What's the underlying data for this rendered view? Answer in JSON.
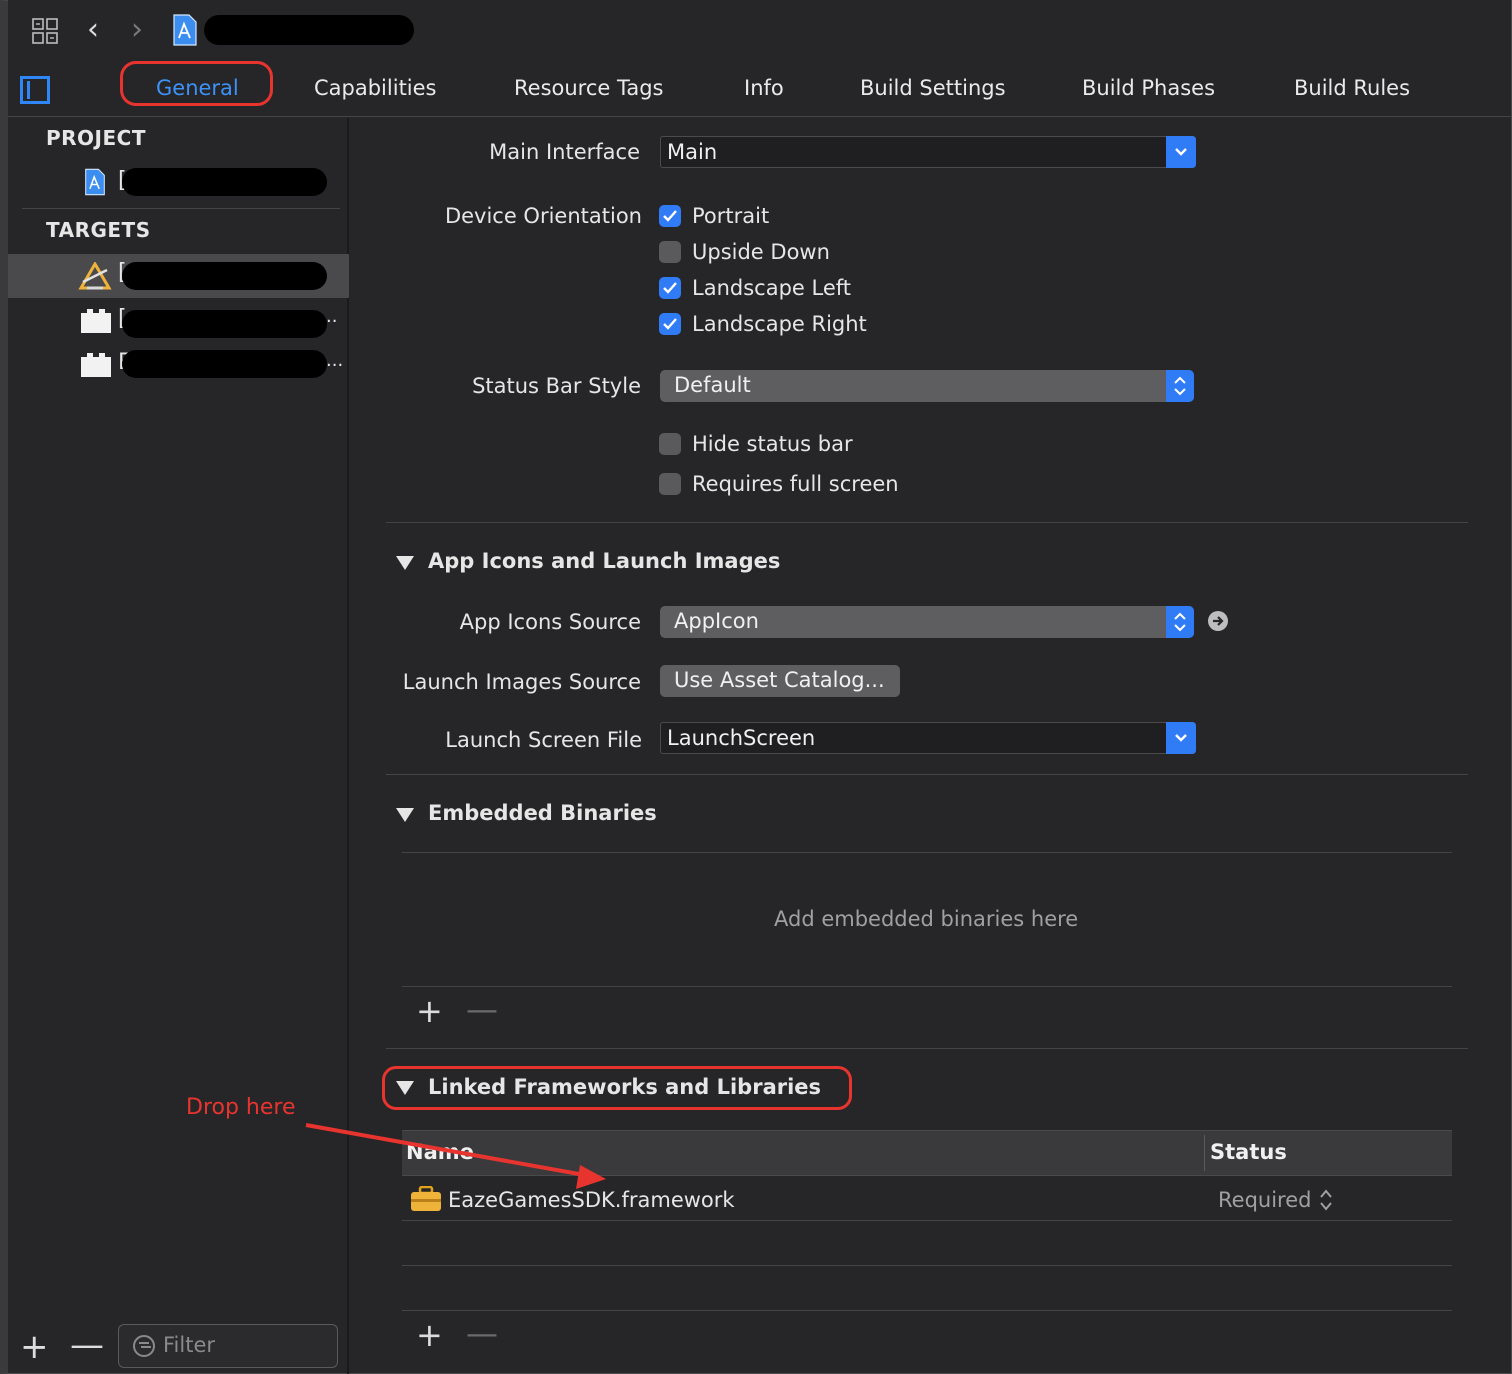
{
  "toolbar": {
    "icons": [
      "related-items-grid-icon",
      "back-chevron-icon",
      "forward-chevron-icon",
      "project-file-icon"
    ]
  },
  "tabs": [
    {
      "label": "General",
      "active": true
    },
    {
      "label": "Capabilities"
    },
    {
      "label": "Resource Tags"
    },
    {
      "label": "Info"
    },
    {
      "label": "Build Settings"
    },
    {
      "label": "Build Phases"
    },
    {
      "label": "Build Rules"
    }
  ],
  "navigator": {
    "project_header": "PROJECT",
    "targets_header": "TARGETS",
    "project_row_prefix": "[",
    "target_rows": [
      {
        "prefix": "[",
        "suffix": "",
        "selected": true
      },
      {
        "prefix": "[",
        "suffix": ".."
      },
      {
        "prefix": "E",
        "suffix": "..."
      }
    ],
    "filter_placeholder": "Filter"
  },
  "deployment": {
    "main_interface_label": "Main Interface",
    "main_interface_value": "Main",
    "device_orientation_label": "Device Orientation",
    "orientations": [
      {
        "label": "Portrait",
        "checked": true
      },
      {
        "label": "Upside Down",
        "checked": false
      },
      {
        "label": "Landscape Left",
        "checked": true
      },
      {
        "label": "Landscape Right",
        "checked": true
      }
    ],
    "status_bar_style_label": "Status Bar Style",
    "status_bar_style_value": "Default",
    "hide_status_bar_label": "Hide status bar",
    "hide_status_bar_checked": false,
    "requires_full_screen_label": "Requires full screen",
    "requires_full_screen_checked": false
  },
  "app_icons": {
    "section_title": "App Icons and Launch Images",
    "app_icons_source_label": "App Icons Source",
    "app_icons_source_value": "AppIcon",
    "launch_images_source_label": "Launch Images Source",
    "launch_images_source_button": "Use Asset Catalog...",
    "launch_screen_file_label": "Launch Screen File",
    "launch_screen_file_value": "LaunchScreen"
  },
  "embedded_binaries": {
    "section_title": "Embedded Binaries",
    "empty_text": "Add embedded binaries here",
    "add": "+",
    "remove": "—"
  },
  "linked_frameworks": {
    "section_title": "Linked Frameworks and Libraries",
    "columns": [
      "Name",
      "Status"
    ],
    "rows": [
      {
        "name": "EazeGamesSDK.framework",
        "status": "Required"
      }
    ],
    "add": "+",
    "remove": "—"
  },
  "annotation": {
    "note": "Drop here",
    "color": "#e8342f"
  },
  "colors": {
    "accent": "#2f7cf6",
    "background": "#262628",
    "annotation_red": "#e8342f"
  }
}
